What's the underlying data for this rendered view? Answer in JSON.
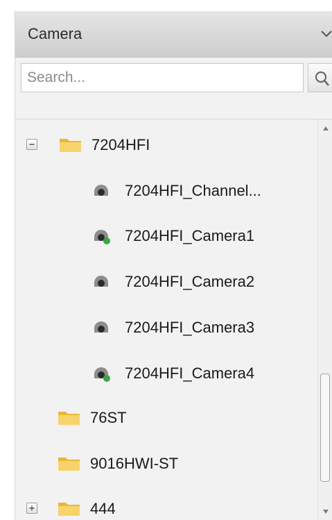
{
  "header": {
    "title": "Camera",
    "chevron_icon": "chevron-down-icon"
  },
  "search": {
    "placeholder": "Search...",
    "value": "",
    "icon": "search-icon"
  },
  "tree": {
    "items": [
      {
        "label": "7204HFI",
        "type": "folder",
        "expander": "collapse"
      },
      {
        "label": "7204HFI_Channel...",
        "type": "camera",
        "online": false
      },
      {
        "label": "7204HFI_Camera1",
        "type": "camera",
        "online": true
      },
      {
        "label": "7204HFI_Camera2",
        "type": "camera",
        "online": false
      },
      {
        "label": "7204HFI_Camera3",
        "type": "camera",
        "online": false
      },
      {
        "label": "7204HFI_Camera4",
        "type": "camera",
        "online": true
      },
      {
        "label": "76ST",
        "type": "folder"
      },
      {
        "label": "9016HWI-ST",
        "type": "folder"
      },
      {
        "label": "444",
        "type": "folder",
        "expander": "expand"
      }
    ]
  },
  "colors": {
    "folder": "#f3c94d",
    "online_indicator": "#3aa64a"
  }
}
